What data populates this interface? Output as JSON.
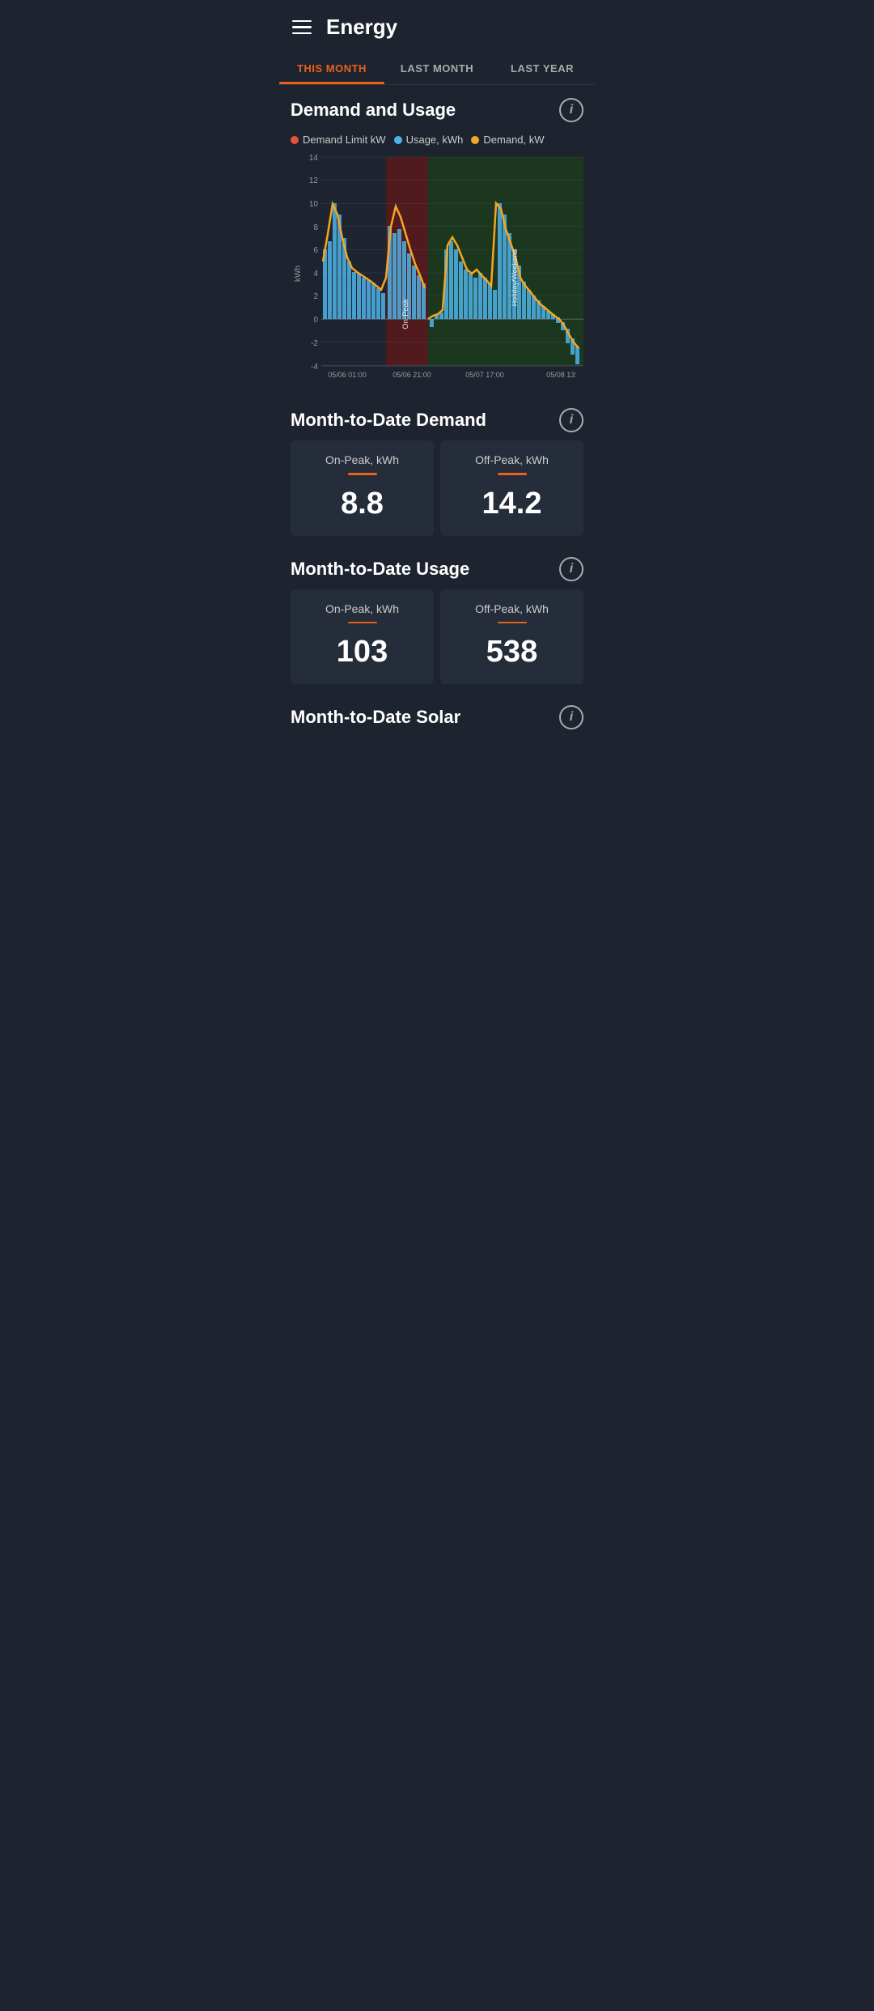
{
  "header": {
    "title": "Energy"
  },
  "tabs": [
    {
      "label": "THIS MONTH",
      "active": true
    },
    {
      "label": "LAST MONTH",
      "active": false
    },
    {
      "label": "LAST YEAR",
      "active": false
    }
  ],
  "demand_usage_section": {
    "title": "Demand and Usage",
    "info_icon": "i",
    "legend": [
      {
        "label": "Demand Limit kW",
        "color": "#e8503a"
      },
      {
        "label": "Usage, kWh",
        "color": "#4fb3e8"
      },
      {
        "label": "Demand, kW",
        "color": "#f5a623"
      }
    ],
    "x_labels": [
      "05/06 01:00",
      "05/06 21:00",
      "05/07 17:00",
      "05/08 13:"
    ],
    "y_labels": [
      "14",
      "12",
      "10",
      "8",
      "6",
      "4",
      "2",
      "0",
      "-2",
      "-4"
    ],
    "y_axis_label": "kWh"
  },
  "month_to_date_demand": {
    "title": "Month-to-Date Demand",
    "on_peak_label": "On-Peak, kWh",
    "on_peak_value": "8.8",
    "off_peak_label": "Off-Peak, kWh",
    "off_peak_value": "14.2"
  },
  "month_to_date_usage": {
    "title": "Month-to-Date Usage",
    "on_peak_label": "On-Peak, kWh",
    "on_peak_value": "103",
    "off_peak_label": "Off-Peak, kWh",
    "off_peak_value": "538"
  },
  "month_to_date_solar": {
    "title": "Month-to-Date Solar"
  },
  "colors": {
    "accent": "#e8621a",
    "blue": "#4fb3e8",
    "gold": "#f5a623",
    "red": "#e8503a",
    "bg": "#1e2330",
    "card_bg": "#252c3a",
    "on_peak_bg": "#6b1a1a",
    "holiday_bg": "#1e4a1e"
  }
}
